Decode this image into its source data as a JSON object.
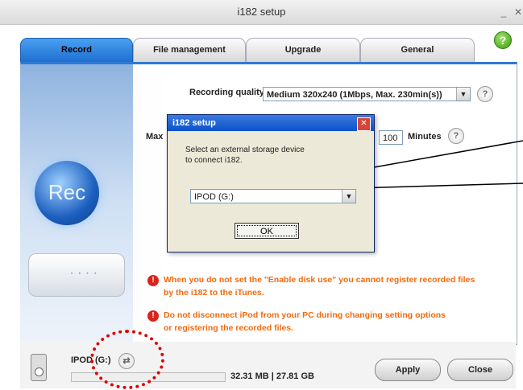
{
  "window": {
    "title": "i182 setup"
  },
  "tabs": [
    "Record",
    "File management",
    "Upgrade",
    "General"
  ],
  "help_icon": {
    "label": "?",
    "icon": "help-icon"
  },
  "sidebar": {
    "rec_label": "Rec"
  },
  "recording": {
    "quality_label": "Recording quality:",
    "quality_value": "Medium 320x240 (1Mbps, Max. 230min(s))",
    "max_label": "Max",
    "max_value": "100",
    "minutes_label": "Minutes"
  },
  "warnings": [
    {
      "line1": "When you do not set the \"Enable disk use\" you cannot register recorded files",
      "line2": "by the i182 to the iTunes."
    },
    {
      "line1": "Do not disconnect iPod from your PC during changing setting options",
      "line2": "or registering the recorded files."
    }
  ],
  "status": {
    "device_label": "IPOD (G:)",
    "storage_text": "32.31 MB | 27.81 GB",
    "apply_label": "Apply",
    "close_label": "Close"
  },
  "dialog": {
    "title": "i182 setup",
    "message_line1": "Select an external storage device",
    "message_line2": "to connect i182.",
    "device_value": "IPOD (G:)",
    "ok_label": "OK"
  },
  "colors": {
    "accent": "#2e7ad6",
    "warning": "#f26a0d",
    "annotation": "#e00000"
  }
}
